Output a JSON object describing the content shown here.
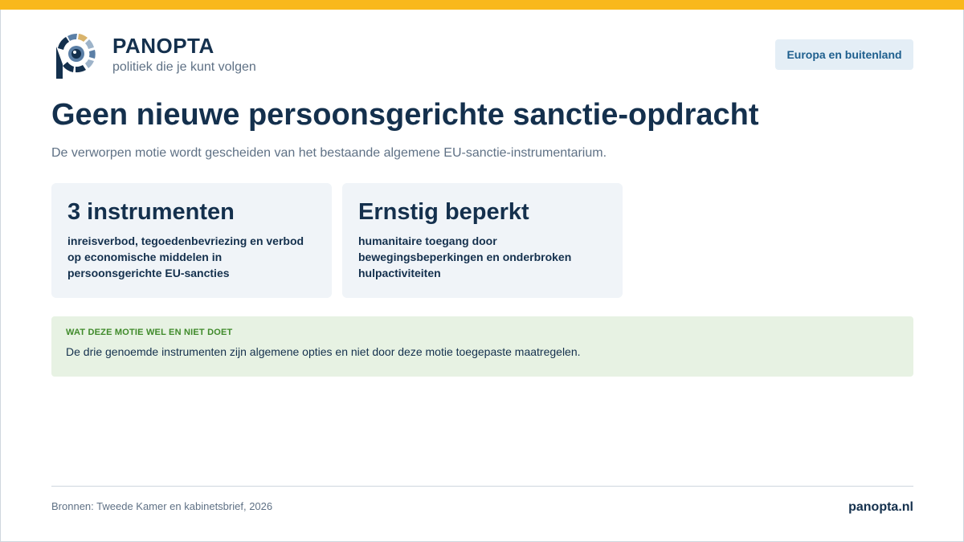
{
  "brand": {
    "name": "PANOPTA",
    "tagline": "politiek die je kunt volgen"
  },
  "category_badge": "Europa en buitenland",
  "page_title": "Geen nieuwe persoonsgerichte sanctie-opdracht",
  "subtitle": "De verworpen motie wordt gescheiden van het bestaande algemene EU-sanctie-instrumentarium.",
  "cards": [
    {
      "heading": "3 instrumenten",
      "text": "inreisverbod, tegoedenbevriezing en verbod op economische middelen in persoonsgerichte EU-sancties"
    },
    {
      "heading": "Ernstig beperkt",
      "text": "humanitaire toegang door bewegingsbeperkingen en onderbroken hulpactiviteiten"
    }
  ],
  "info_box": {
    "label": "WAT DEZE MOTIE WEL EN NIET DOET",
    "text": "De drie genoemde instrumenten zijn algemene opties en niet door deze motie toegepaste maatregelen."
  },
  "footer": {
    "sources": "Bronnen: Tweede Kamer en kabinetsbrief, 2026",
    "site": "panopta.nl"
  },
  "colors": {
    "accent_bar": "#f9b81c",
    "navy": "#14304d",
    "badge_bg": "#e4eef6",
    "card_bg": "#f0f4f8",
    "info_bg": "#e7f2e3",
    "info_label": "#3f8a2a"
  },
  "icons": {
    "logo": "panopta-eye-logo"
  }
}
